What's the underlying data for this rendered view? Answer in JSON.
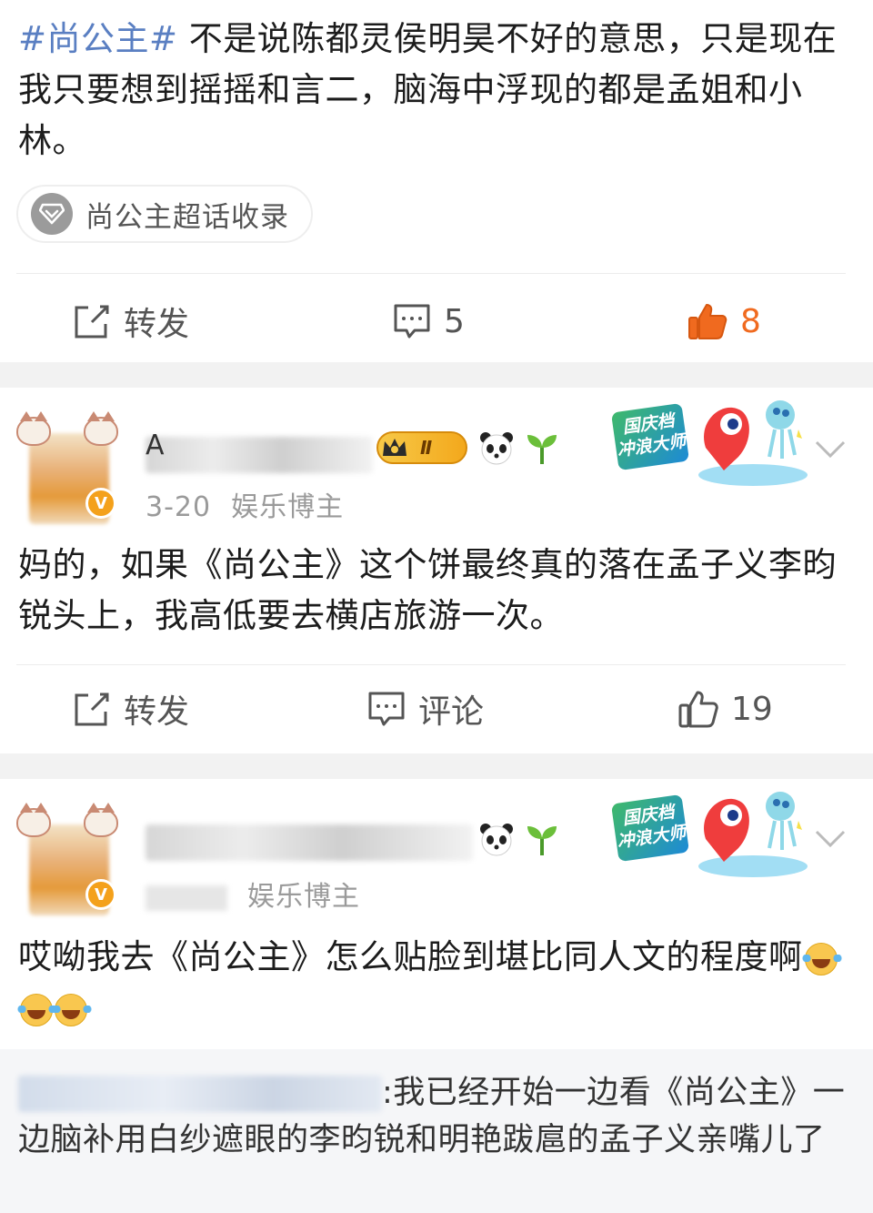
{
  "posts": [
    {
      "hashtag": "#尚公主#",
      "text": " 不是说陈都灵侯明昊不好的意思，只是现在我只要想到摇摇和言二，脑海中浮现的都是孟姐和小林。",
      "topic_chip": "尚公主超话收录",
      "actions": {
        "repost": "转发",
        "comments": "5",
        "likes": "8"
      }
    },
    {
      "name_partial": "A",
      "date": "3-20",
      "category": "娱乐博主",
      "level_badge": "Ⅱ",
      "promo": "国庆档\n冲浪大师",
      "text": "妈的，如果《尚公主》这个饼最终真的落在孟子义李昀锐头上，我高低要去横店旅游一次。",
      "actions": {
        "repost": "转发",
        "comment": "评论",
        "likes": "19"
      }
    },
    {
      "category": "娱乐博主",
      "promo": "国庆档\n冲浪大师",
      "text": "哎呦我去《尚公主》怎么贴脸到堪比同人文的程度啊",
      "quote": {
        "text": ":我已经开始一边看《尚公主》一边脑补用白纱遮眼的李昀锐和明艳跋扈的孟子义亲嘴儿了"
      }
    }
  ],
  "colors": {
    "hashtag": "#5a7fc2",
    "liked": "#f06a1f",
    "icon_gray": "#555555"
  },
  "icons": [
    "topic-diamond-icon",
    "share-icon",
    "comment-icon",
    "thumbs-up-icon",
    "crown-icon",
    "panda-icon",
    "sprout-icon",
    "chevron-down-icon",
    "laugh-cry-emoji"
  ]
}
